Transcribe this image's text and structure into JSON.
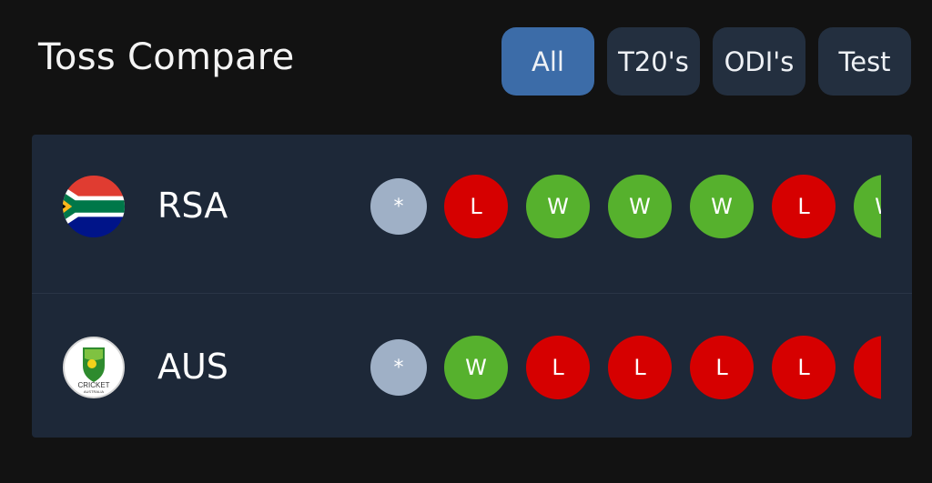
{
  "header": {
    "title": "Toss Compare"
  },
  "filters": [
    {
      "label": "All",
      "active": true
    },
    {
      "label": "T20's",
      "active": false
    },
    {
      "label": "ODI's",
      "active": false
    },
    {
      "label": "Test",
      "active": false
    }
  ],
  "colors": {
    "win": "#56b12d",
    "loss": "#d60000",
    "pending": "#9fb0c6",
    "active_filter": "#3c6ca8",
    "filter": "#232f3f",
    "card": "#1d2838"
  },
  "teams": [
    {
      "name": "RSA",
      "logo": "south-africa-flag",
      "results": [
        "*",
        "L",
        "W",
        "W",
        "W",
        "L",
        "W"
      ]
    },
    {
      "name": "AUS",
      "logo": "cricket-australia-logo",
      "logo_text": "CRICKET",
      "logo_subtext": "AUSTRALIA",
      "results": [
        "*",
        "W",
        "L",
        "L",
        "L",
        "L",
        "L"
      ]
    }
  ]
}
